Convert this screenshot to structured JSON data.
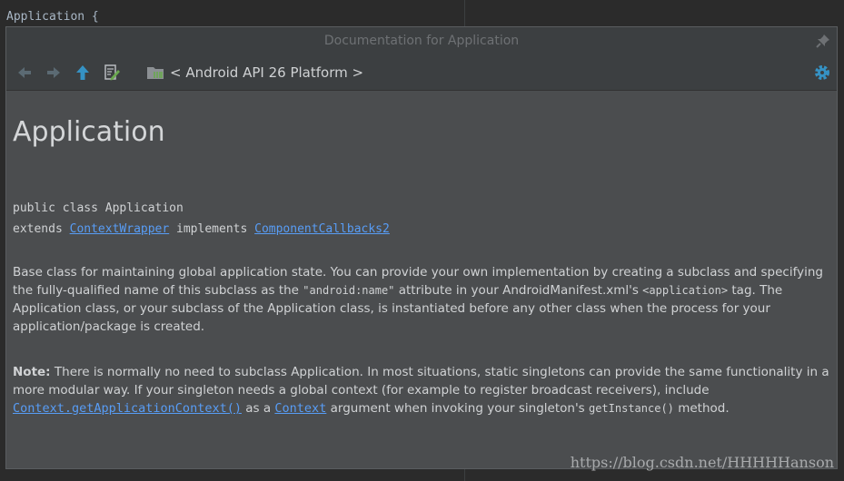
{
  "editor": {
    "code_line": "Application {"
  },
  "popup": {
    "title": "Documentation for Application",
    "breadcrumb": "< Android API 26 Platform >"
  },
  "doc": {
    "heading": "Application",
    "decl_line1": "public class Application",
    "extends_kw": "extends ",
    "extends_link": "ContextWrapper",
    "implements_kw": " implements ",
    "implements_link": "ComponentCallbacks2",
    "p1_a": "Base class for maintaining global application state. You can provide your own implementation by creating a subclass and specifying the fully-qualified name of this subclass as the ",
    "p1_code1": "\"android:name\"",
    "p1_b": " attribute in your AndroidManifest.xml's ",
    "p1_code2": "<application>",
    "p1_c": " tag. The Application class, or your subclass of the Application class, is instantiated before any other class when the process for your application/package is created.",
    "note_label": "Note:",
    "p2_a": " There is normally no need to subclass Application. In most situations, static singletons can provide the same functionality in a more modular way. If your singleton needs a global context (for example to register broadcast receivers), include ",
    "p2_link1": "Context.getApplicationContext()",
    "p2_b": " as a ",
    "p2_link2": "Context",
    "p2_c": " argument when invoking your singleton's ",
    "p2_code": "getInstance()",
    "p2_d": " method."
  },
  "watermark": "https://blog.csdn.net/HHHHHanson",
  "colors": {
    "link": "#589df6",
    "accent": "#3592c4"
  }
}
